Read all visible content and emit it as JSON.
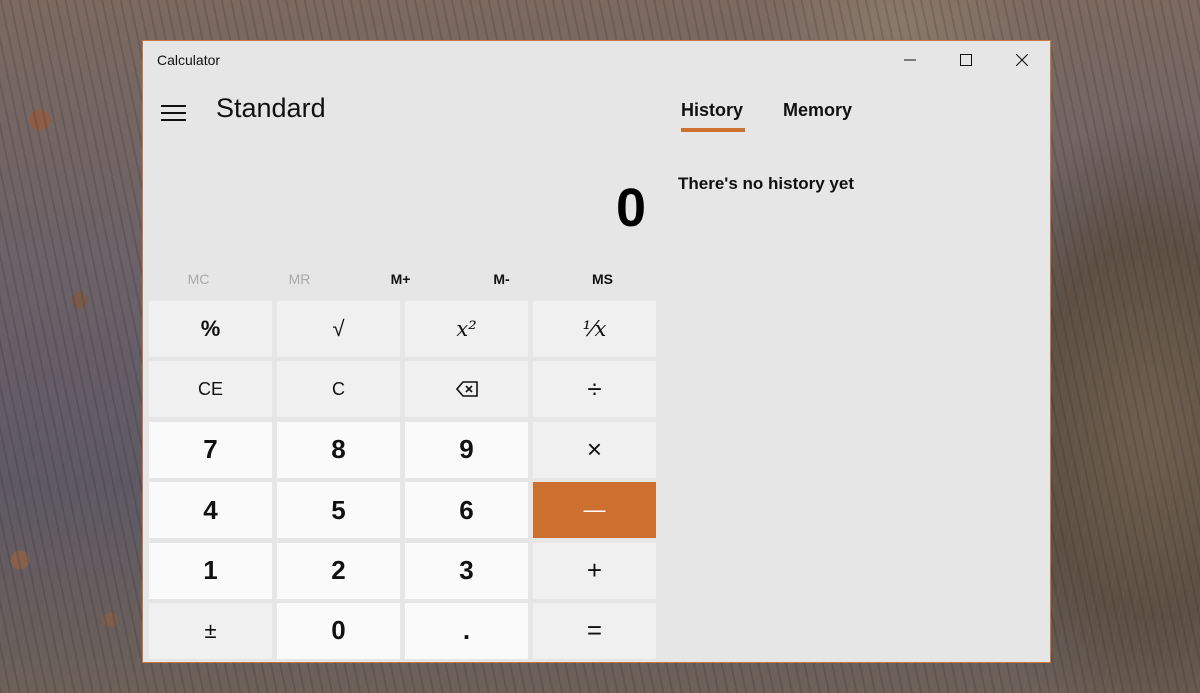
{
  "window": {
    "title": "Calculator",
    "accent_color": "#cd6f2f",
    "border_color": "#c9773f"
  },
  "window_controls": {
    "minimize_icon": "minimize-icon",
    "maximize_icon": "maximize-icon",
    "close_icon": "close-icon"
  },
  "header": {
    "menu_icon": "hamburger-menu-icon",
    "mode": "Standard"
  },
  "display": {
    "value": "0"
  },
  "memory": {
    "buttons": [
      {
        "label": "MC",
        "enabled": false
      },
      {
        "label": "MR",
        "enabled": false
      },
      {
        "label": "M+",
        "enabled": true
      },
      {
        "label": "M-",
        "enabled": true
      },
      {
        "label": "MS",
        "enabled": true
      }
    ]
  },
  "keypad": {
    "keys": [
      {
        "label": "%",
        "name": "percent-button"
      },
      {
        "label": "√",
        "name": "square-root-button"
      },
      {
        "label": "x²",
        "name": "square-button"
      },
      {
        "label": "¹⁄x",
        "name": "reciprocal-button"
      },
      {
        "label": "CE",
        "name": "clear-entry-button"
      },
      {
        "label": "C",
        "name": "clear-button"
      },
      {
        "label": "⌫",
        "name": "backspace-button",
        "icon": "backspace-icon"
      },
      {
        "label": "÷",
        "name": "divide-button"
      },
      {
        "label": "7",
        "name": "digit-7-button"
      },
      {
        "label": "8",
        "name": "digit-8-button"
      },
      {
        "label": "9",
        "name": "digit-9-button"
      },
      {
        "label": "×",
        "name": "multiply-button"
      },
      {
        "label": "4",
        "name": "digit-4-button"
      },
      {
        "label": "5",
        "name": "digit-5-button"
      },
      {
        "label": "6",
        "name": "digit-6-button"
      },
      {
        "label": "—",
        "name": "subtract-button",
        "active": true
      },
      {
        "label": "1",
        "name": "digit-1-button"
      },
      {
        "label": "2",
        "name": "digit-2-button"
      },
      {
        "label": "3",
        "name": "digit-3-button"
      },
      {
        "label": "+",
        "name": "add-button"
      },
      {
        "label": "±",
        "name": "negate-button"
      },
      {
        "label": "0",
        "name": "digit-0-button"
      },
      {
        "label": ".",
        "name": "decimal-button"
      },
      {
        "label": "=",
        "name": "equals-button"
      }
    ]
  },
  "panel": {
    "tabs": [
      {
        "label": "History",
        "selected": true
      },
      {
        "label": "Memory",
        "selected": false
      }
    ],
    "empty_message": "There's no history yet"
  }
}
